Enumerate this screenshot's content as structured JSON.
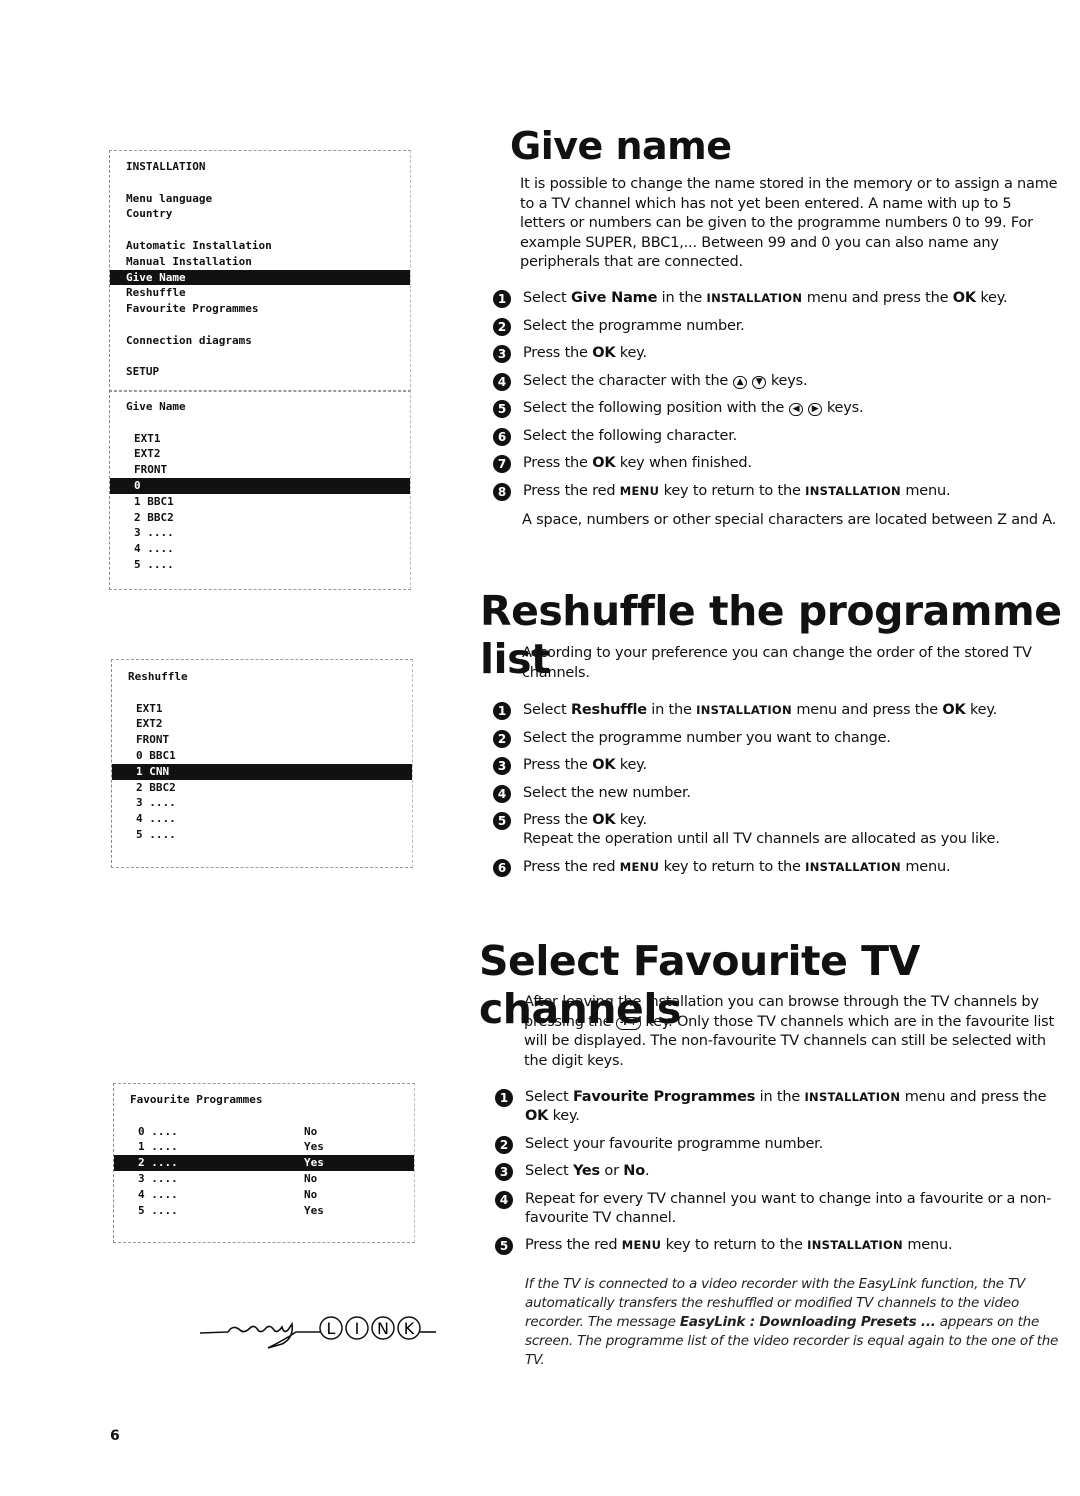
{
  "menus": {
    "installation": {
      "title": "INSTALLATION",
      "items": [
        "Menu language",
        "Country",
        "Automatic Installation",
        "Manual Installation",
        "Give Name",
        "Reshuffle",
        "Favourite Programmes",
        "Connection diagrams",
        "SETUP"
      ],
      "selected": "Give Name"
    },
    "give_name": {
      "title": "Give Name",
      "items": [
        "EXT1",
        "EXT2",
        "FRONT",
        "0",
        "1 BBC1",
        "2 BBC2",
        "3 ....",
        "4 ....",
        "5 ...."
      ],
      "selected": "0"
    },
    "reshuffle": {
      "title": "Reshuffle",
      "items": [
        "EXT1",
        "EXT2",
        "FRONT",
        "0 BBC1",
        "1 CNN",
        "2 BBC2",
        "3 ....",
        "4 ....",
        "5 ...."
      ],
      "selected": "1 CNN"
    },
    "favourite": {
      "title": "Favourite Programmes",
      "rows": [
        {
          "prog": "0 ....",
          "value": "No"
        },
        {
          "prog": "1 ....",
          "value": "Yes"
        },
        {
          "prog": "2 ....",
          "value": "Yes"
        },
        {
          "prog": "3 ....",
          "value": "No"
        },
        {
          "prog": "4 ....",
          "value": "No"
        },
        {
          "prog": "5 ....",
          "value": "Yes"
        }
      ],
      "selected": "2 ...."
    }
  },
  "sections": [
    {
      "title": "Give name",
      "intro": "It is possible to change the name stored in the memory or to assign a name to a TV channel which has not yet been entered. A name with up to 5 letters or numbers can be given to the programme numbers 0 to 99. For example SUPER, BBC1,... Between 99 and 0 you can also name any peripherals that are connected.",
      "steps": [
        [
          {
            "t": "Select "
          },
          {
            "t": "Give Name",
            "s": "b"
          },
          {
            "t": " in the "
          },
          {
            "t": "INSTALLATION",
            "s": "sc"
          },
          {
            "t": " menu and press the "
          },
          {
            "t": "OK",
            "s": "b"
          },
          {
            "t": " key."
          }
        ],
        [
          {
            "t": "Select the programme number."
          }
        ],
        [
          {
            "t": "Press the "
          },
          {
            "t": "OK",
            "s": "b"
          },
          {
            "t": " key."
          }
        ],
        [
          {
            "t": "Select the character with the "
          },
          {
            "t": "▲",
            "s": "key"
          },
          {
            "t": " "
          },
          {
            "t": "▼",
            "s": "key"
          },
          {
            "t": " keys."
          }
        ],
        [
          {
            "t": "Select the following position with the "
          },
          {
            "t": "◀",
            "s": "key"
          },
          {
            "t": " "
          },
          {
            "t": "▶",
            "s": "key"
          },
          {
            "t": " keys."
          }
        ],
        [
          {
            "t": "Select the following character."
          }
        ],
        [
          {
            "t": "Press the "
          },
          {
            "t": "OK",
            "s": "b"
          },
          {
            "t": " key when finished."
          }
        ],
        [
          {
            "t": "Press the red "
          },
          {
            "t": "MENU",
            "s": "sc"
          },
          {
            "t": " key to return to the "
          },
          {
            "t": "INSTALLATION",
            "s": "sc"
          },
          {
            "t": " menu."
          }
        ]
      ],
      "after": "A space, numbers or other special characters are located between Z and A."
    },
    {
      "title": "Reshuffle the programme list",
      "intro": "According to your preference you can change the order of the stored TV channels.",
      "steps": [
        [
          {
            "t": "Select "
          },
          {
            "t": "Reshuffle",
            "s": "b"
          },
          {
            "t": " in the "
          },
          {
            "t": "INSTALLATION",
            "s": "sc"
          },
          {
            "t": " menu and press the "
          },
          {
            "t": "OK",
            "s": "b"
          },
          {
            "t": " key."
          }
        ],
        [
          {
            "t": "Select the programme number you want to change."
          }
        ],
        [
          {
            "t": "Press the "
          },
          {
            "t": "OK",
            "s": "b"
          },
          {
            "t": " key."
          }
        ],
        [
          {
            "t": "Select the new number."
          }
        ],
        [
          {
            "t": "Press the "
          },
          {
            "t": "OK",
            "s": "b"
          },
          {
            "t": " key."
          },
          {
            "t": "Repeat the operation until all TV channels are allocated as you like.",
            "s": "br"
          }
        ],
        [
          {
            "t": "Press the red "
          },
          {
            "t": "MENU",
            "s": "sc"
          },
          {
            "t": " key to return to the "
          },
          {
            "t": "INSTALLATION",
            "s": "sc"
          },
          {
            "t": " menu."
          }
        ]
      ]
    },
    {
      "title": "Select Favourite TV channels",
      "intro_parts": [
        {
          "t": "After leaving the installation you can browse through the TV channels by pressing the "
        },
        {
          "t": "-P+",
          "s": "key"
        },
        {
          "t": " key.  Only those TV channels which are in the favourite list will be displayed. The non-favourite TV channels can still be selected with the digit keys."
        }
      ],
      "steps": [
        [
          {
            "t": "Select "
          },
          {
            "t": "Favourite Programmes",
            "s": "b"
          },
          {
            "t": " in the "
          },
          {
            "t": "INSTALLATION",
            "s": "sc"
          },
          {
            "t": " menu and press the "
          },
          {
            "t": "OK",
            "s": "b"
          },
          {
            "t": " key."
          }
        ],
        [
          {
            "t": "Select your favourite programme number."
          }
        ],
        [
          {
            "t": "Select "
          },
          {
            "t": "Yes",
            "s": "b"
          },
          {
            "t": " or "
          },
          {
            "t": "No",
            "s": "b"
          },
          {
            "t": "."
          }
        ],
        [
          {
            "t": "Repeat for every TV channel you want to change into a favourite or a non-favourite TV channel."
          }
        ],
        [
          {
            "t": "Press the red "
          },
          {
            "t": "MENU",
            "s": "sc"
          },
          {
            "t": " key to return to the "
          },
          {
            "t": "INSTALLATION",
            "s": "sc"
          },
          {
            "t": " menu."
          }
        ]
      ],
      "note": [
        {
          "t": "If the TV is connected to a video recorder with the EasyLink function, the TV automatically transfers the reshuffled or modified TV channels to the video recorder. The message "
        },
        {
          "t": "EasyLink : Downloading Presets ...",
          "s": "b"
        },
        {
          "t": "  appears on the screen.  The programme list of the video recorder is equal again to the one of the TV."
        }
      ]
    }
  ],
  "logo": {
    "text": "easy LINK",
    "letters": [
      "L",
      "I",
      "N",
      "K"
    ]
  },
  "page_number": "6",
  "icons": {
    "step_number": "filled-circle-number",
    "up_down_keys": "cursor-up-down",
    "left_right_keys": "cursor-left-right",
    "program_key": "program-plus-minus"
  }
}
